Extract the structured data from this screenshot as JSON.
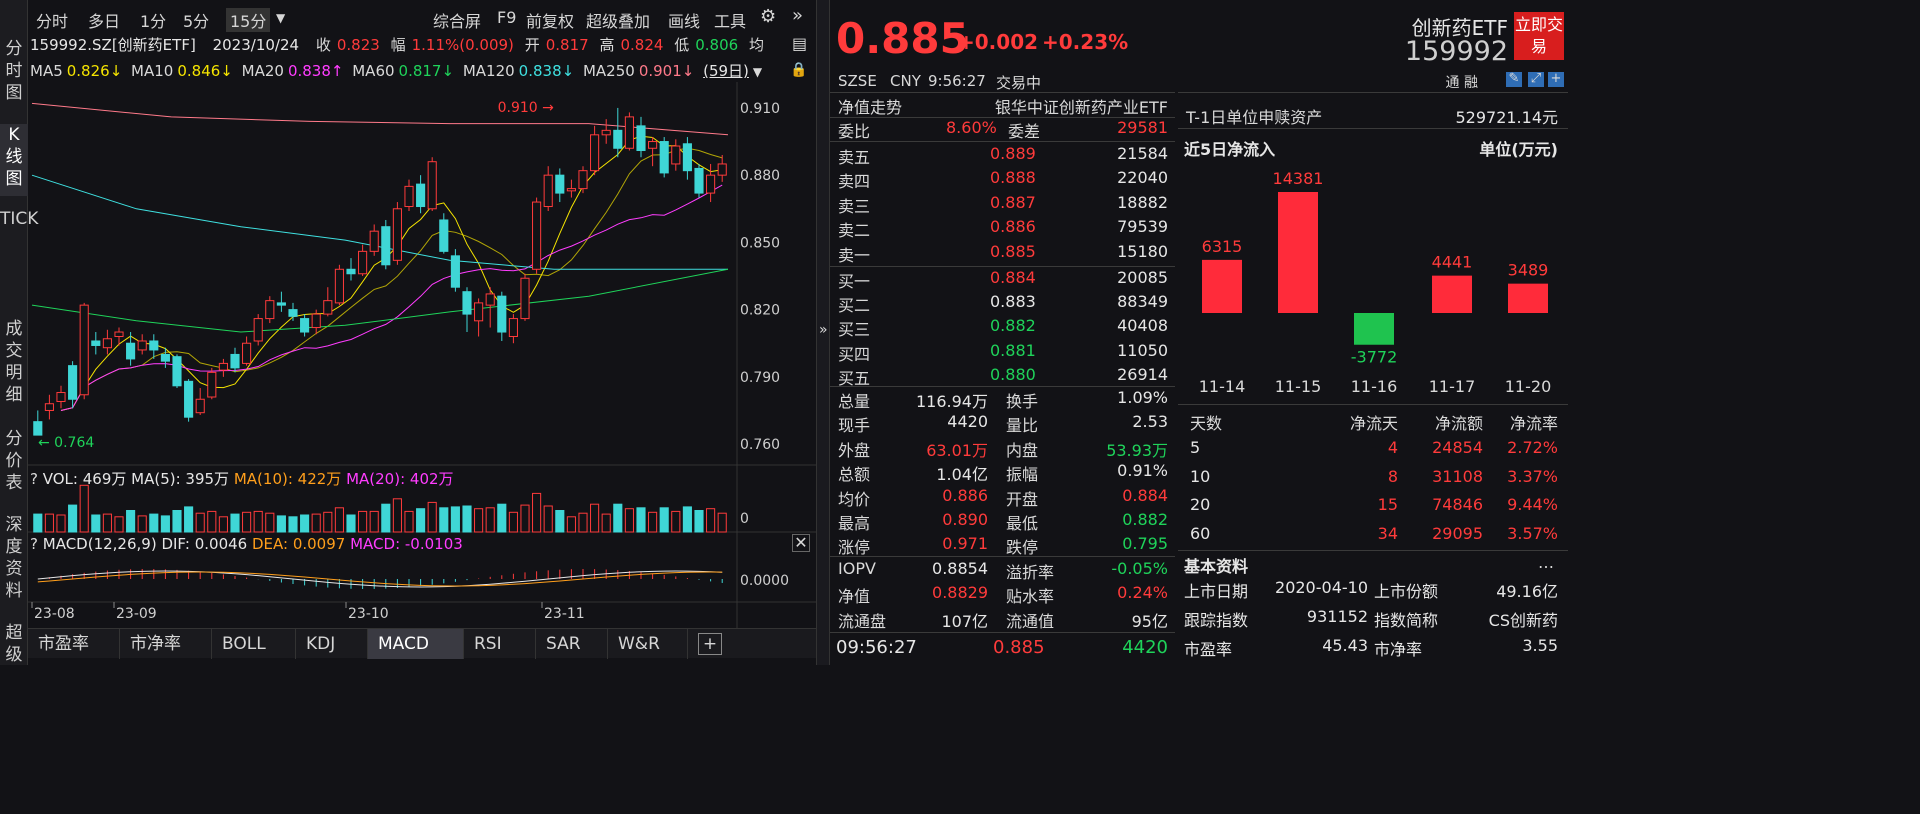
{
  "leftbar": {
    "items": [
      "分时图",
      "K线图",
      "TICK",
      "成交明细",
      "分价表",
      "深度资料",
      "超级"
    ]
  },
  "toolbar": {
    "periods": [
      "分时",
      "多日",
      "1分",
      "5分",
      "15分"
    ],
    "actions": [
      "综合屏",
      "F9",
      "前复权",
      "超级叠加",
      "画线",
      "工具"
    ]
  },
  "info": {
    "code": "159992.SZ[创新药ETF]",
    "date": "2023/10/24",
    "close_label": "收",
    "close": "0.823",
    "range_label": "幅",
    "range": "1.11%(0.009)",
    "open_label": "开",
    "open": "0.817",
    "high_label": "高",
    "high": "0.824",
    "low_label": "低",
    "low": "0.806",
    "avg_label": "均"
  },
  "ma": {
    "ma5_label": "MA5",
    "ma5": "0.826↓",
    "ma10_label": "MA10",
    "ma10": "0.846↓",
    "ma20_label": "MA20",
    "ma20": "0.838↑",
    "ma60_label": "MA60",
    "ma60": "0.817↓",
    "ma120_label": "MA120",
    "ma120": "0.838↓",
    "ma250_label": "MA250",
    "ma250": "0.901↓",
    "days": "(59日)"
  },
  "chart_data": [
    {
      "type": "candlestick",
      "y_ticks": [
        "0.910",
        "0.880",
        "0.850",
        "0.820",
        "0.790",
        "0.760"
      ],
      "ylim": [
        0.752,
        0.918
      ],
      "x_ticks": [
        "23-08",
        "23-09",
        "23-10",
        "23-11"
      ],
      "annotations": [
        {
          "text": "0.910",
          "x_index": 46
        },
        {
          "text": "0.764",
          "x_index": 0
        }
      ],
      "candles": [
        {
          "o": 0.77,
          "c": 0.764,
          "h": 0.775,
          "l": 0.764
        },
        {
          "o": 0.775,
          "c": 0.778,
          "h": 0.782,
          "l": 0.771
        },
        {
          "o": 0.779,
          "c": 0.783,
          "h": 0.786,
          "l": 0.776
        },
        {
          "o": 0.795,
          "c": 0.78,
          "h": 0.797,
          "l": 0.776
        },
        {
          "o": 0.782,
          "c": 0.822,
          "h": 0.823,
          "l": 0.78
        },
        {
          "o": 0.806,
          "c": 0.804,
          "h": 0.81,
          "l": 0.8
        },
        {
          "o": 0.803,
          "c": 0.807,
          "h": 0.811,
          "l": 0.8
        },
        {
          "o": 0.808,
          "c": 0.81,
          "h": 0.812,
          "l": 0.804
        },
        {
          "o": 0.805,
          "c": 0.798,
          "h": 0.81,
          "l": 0.795
        },
        {
          "o": 0.802,
          "c": 0.806,
          "h": 0.809,
          "l": 0.8
        },
        {
          "o": 0.806,
          "c": 0.802,
          "h": 0.809,
          "l": 0.798
        },
        {
          "o": 0.8,
          "c": 0.797,
          "h": 0.803,
          "l": 0.794
        },
        {
          "o": 0.799,
          "c": 0.786,
          "h": 0.8,
          "l": 0.785
        },
        {
          "o": 0.788,
          "c": 0.772,
          "h": 0.789,
          "l": 0.77
        },
        {
          "o": 0.774,
          "c": 0.78,
          "h": 0.785,
          "l": 0.773
        },
        {
          "o": 0.781,
          "c": 0.792,
          "h": 0.794,
          "l": 0.78
        },
        {
          "o": 0.793,
          "c": 0.796,
          "h": 0.798,
          "l": 0.79
        },
        {
          "o": 0.8,
          "c": 0.794,
          "h": 0.803,
          "l": 0.792
        },
        {
          "o": 0.796,
          "c": 0.805,
          "h": 0.808,
          "l": 0.795
        },
        {
          "o": 0.806,
          "c": 0.816,
          "h": 0.818,
          "l": 0.804
        },
        {
          "o": 0.816,
          "c": 0.824,
          "h": 0.826,
          "l": 0.814
        },
        {
          "o": 0.823,
          "c": 0.822,
          "h": 0.828,
          "l": 0.819
        },
        {
          "o": 0.82,
          "c": 0.817,
          "h": 0.823,
          "l": 0.815
        },
        {
          "o": 0.816,
          "c": 0.81,
          "h": 0.818,
          "l": 0.808
        },
        {
          "o": 0.812,
          "c": 0.818,
          "h": 0.82,
          "l": 0.809
        },
        {
          "o": 0.818,
          "c": 0.824,
          "h": 0.83,
          "l": 0.817
        },
        {
          "o": 0.823,
          "c": 0.838,
          "h": 0.84,
          "l": 0.822
        },
        {
          "o": 0.838,
          "c": 0.836,
          "h": 0.843,
          "l": 0.833
        },
        {
          "o": 0.836,
          "c": 0.846,
          "h": 0.849,
          "l": 0.835
        },
        {
          "o": 0.846,
          "c": 0.855,
          "h": 0.858,
          "l": 0.844
        },
        {
          "o": 0.857,
          "c": 0.84,
          "h": 0.86,
          "l": 0.838
        },
        {
          "o": 0.842,
          "c": 0.865,
          "h": 0.868,
          "l": 0.84
        },
        {
          "o": 0.866,
          "c": 0.875,
          "h": 0.878,
          "l": 0.864
        },
        {
          "o": 0.876,
          "c": 0.866,
          "h": 0.88,
          "l": 0.863
        },
        {
          "o": 0.865,
          "c": 0.886,
          "h": 0.888,
          "l": 0.864
        },
        {
          "o": 0.86,
          "c": 0.846,
          "h": 0.863,
          "l": 0.845
        },
        {
          "o": 0.844,
          "c": 0.83,
          "h": 0.847,
          "l": 0.828
        },
        {
          "o": 0.828,
          "c": 0.818,
          "h": 0.83,
          "l": 0.81
        },
        {
          "o": 0.815,
          "c": 0.823,
          "h": 0.825,
          "l": 0.808
        },
        {
          "o": 0.822,
          "c": 0.827,
          "h": 0.83,
          "l": 0.812
        },
        {
          "o": 0.826,
          "c": 0.81,
          "h": 0.828,
          "l": 0.806
        },
        {
          "o": 0.808,
          "c": 0.816,
          "h": 0.818,
          "l": 0.805
        },
        {
          "o": 0.816,
          "c": 0.834,
          "h": 0.836,
          "l": 0.815
        },
        {
          "o": 0.838,
          "c": 0.868,
          "h": 0.87,
          "l": 0.836
        },
        {
          "o": 0.866,
          "c": 0.88,
          "h": 0.884,
          "l": 0.864
        },
        {
          "o": 0.88,
          "c": 0.872,
          "h": 0.883,
          "l": 0.868
        },
        {
          "o": 0.873,
          "c": 0.874,
          "h": 0.878,
          "l": 0.87
        },
        {
          "o": 0.874,
          "c": 0.882,
          "h": 0.884,
          "l": 0.872
        },
        {
          "o": 0.882,
          "c": 0.898,
          "h": 0.902,
          "l": 0.88
        },
        {
          "o": 0.898,
          "c": 0.9,
          "h": 0.905,
          "l": 0.894
        },
        {
          "o": 0.9,
          "c": 0.892,
          "h": 0.91,
          "l": 0.888
        },
        {
          "o": 0.892,
          "c": 0.906,
          "h": 0.908,
          "l": 0.891
        },
        {
          "o": 0.902,
          "c": 0.891,
          "h": 0.906,
          "l": 0.888
        },
        {
          "o": 0.892,
          "c": 0.895,
          "h": 0.897,
          "l": 0.884
        },
        {
          "o": 0.895,
          "c": 0.881,
          "h": 0.897,
          "l": 0.879
        },
        {
          "o": 0.885,
          "c": 0.893,
          "h": 0.896,
          "l": 0.882
        },
        {
          "o": 0.894,
          "c": 0.882,
          "h": 0.897,
          "l": 0.878
        },
        {
          "o": 0.883,
          "c": 0.872,
          "h": 0.885,
          "l": 0.87
        },
        {
          "o": 0.872,
          "c": 0.88,
          "h": 0.885,
          "l": 0.868
        },
        {
          "o": 0.88,
          "c": 0.885,
          "h": 0.889,
          "l": 0.877
        }
      ]
    },
    {
      "type": "bar",
      "name": "volume",
      "label": "VOL: 469万",
      "y_ticks": [
        "0"
      ]
    },
    {
      "type": "bar",
      "name": "macd",
      "y_ticks": [
        "0.0000"
      ]
    }
  ],
  "vol": {
    "label": "VOL: 469万",
    "ma5": "MA(5): 395万",
    "ma10": "MA(10): 422万",
    "ma20": "MA(20): 402万"
  },
  "macd": {
    "label": "MACD(12,26,9)",
    "dif": "DIF: 0.0046",
    "dea": "DEA: 0.0097",
    "macd": "MACD: -0.0103"
  },
  "bottom_tabs": [
    "市盈率",
    "市净率",
    "BOLL",
    "KDJ",
    "MACD",
    "RSI",
    "SAR",
    "W&R"
  ],
  "quote": {
    "price": "0.885",
    "change": "+0.002",
    "change_pct": "+0.23%",
    "name": "创新药ETF",
    "code": "159992",
    "trade_btn": "立即交易",
    "exchange": "SZSE",
    "currency": "CNY",
    "time": "9:56:27",
    "status": "交易中",
    "tongrong": "通 融",
    "nav_trend_label": "净值走势",
    "index_name": "银华中证创新药产业ETF",
    "weibi_label": "委比",
    "weibi": "8.60%",
    "weicha_label": "委差",
    "weicha": "29581",
    "asks": [
      {
        "label": "卖五",
        "price": "0.889",
        "vol": "21584"
      },
      {
        "label": "卖四",
        "price": "0.888",
        "vol": "22040"
      },
      {
        "label": "卖三",
        "price": "0.887",
        "vol": "18882"
      },
      {
        "label": "卖二",
        "price": "0.886",
        "vol": "79539"
      },
      {
        "label": "卖一",
        "price": "0.885",
        "vol": "15180"
      }
    ],
    "bids": [
      {
        "label": "买一",
        "price": "0.884",
        "vol": "20085"
      },
      {
        "label": "买二",
        "price": "0.883",
        "vol": "88349"
      },
      {
        "label": "买三",
        "price": "0.882",
        "vol": "40408"
      },
      {
        "label": "买四",
        "price": "0.881",
        "vol": "11050"
      },
      {
        "label": "买五",
        "price": "0.880",
        "vol": "26914"
      }
    ],
    "stats": [
      {
        "l1": "总量",
        "v1": "116.94万",
        "c1": "wht",
        "l2": "换手",
        "v2": "1.09%",
        "c2": "wht"
      },
      {
        "l1": "现手",
        "v1": "4420",
        "c1": "wht",
        "l2": "量比",
        "v2": "2.53",
        "c2": "wht"
      },
      {
        "l1": "外盘",
        "v1": "63.01万",
        "c1": "red",
        "l2": "内盘",
        "v2": "53.93万",
        "c2": "grn"
      },
      {
        "l1": "总额",
        "v1": "1.04亿",
        "c1": "wht",
        "l2": "振幅",
        "v2": "0.91%",
        "c2": "wht"
      },
      {
        "l1": "均价",
        "v1": "0.886",
        "c1": "red",
        "l2": "开盘",
        "v2": "0.884",
        "c2": "red"
      },
      {
        "l1": "最高",
        "v1": "0.890",
        "c1": "red",
        "l2": "最低",
        "v2": "0.882",
        "c2": "grn"
      },
      {
        "l1": "涨停",
        "v1": "0.971",
        "c1": "red",
        "l2": "跌停",
        "v2": "0.795",
        "c2": "grn"
      }
    ],
    "stats2": [
      {
        "l1": "IOPV",
        "v1": "0.8854",
        "c1": "wht",
        "l2": "溢折率",
        "v2": "-0.05%",
        "c2": "grn"
      },
      {
        "l1": "净值",
        "v1": "0.8829",
        "c1": "red",
        "l2": "贴水率",
        "v2": "0.24%",
        "c2": "red"
      },
      {
        "l1": "流通盘",
        "v1": "107亿",
        "c1": "wht",
        "l2": "流通值",
        "v2": "95亿",
        "c2": "wht"
      }
    ],
    "last_time": "09:56:27",
    "last_price": "0.885",
    "last_vol": "4420"
  },
  "right": {
    "t1_label": "T-1日单位申赎资产",
    "t1_value": "529721.14元",
    "flow_title": "近5日净流入",
    "flow_unit": "单位(万元)",
    "flow_chart": {
      "type": "bar",
      "categories": [
        "11-14",
        "11-15",
        "11-16",
        "11-17",
        "11-20"
      ],
      "values": [
        6315,
        14381,
        -3772,
        4441,
        3489
      ],
      "labels": [
        "6315",
        "14381",
        "-3772",
        "4441",
        "3489"
      ]
    },
    "table_headers": [
      "天数",
      "净流天",
      "净流额",
      "净流率"
    ],
    "table_rows": [
      [
        "5",
        "4",
        "24854",
        "2.72%"
      ],
      [
        "10",
        "8",
        "31108",
        "3.37%"
      ],
      [
        "20",
        "15",
        "74846",
        "9.44%"
      ],
      [
        "60",
        "34",
        "29095",
        "3.57%"
      ]
    ],
    "basic_title": "基本资料",
    "basic": [
      {
        "l1": "上市日期",
        "v1": "2020-04-10",
        "l2": "上市份额",
        "v2": "49.16亿"
      },
      {
        "l1": "跟踪指数",
        "v1": "931152",
        "l2": "指数简称",
        "v2": "CS创新药"
      },
      {
        "l1": "市盈率",
        "v1": "45.43",
        "l2": "市净率",
        "v2": "3.55"
      }
    ]
  }
}
